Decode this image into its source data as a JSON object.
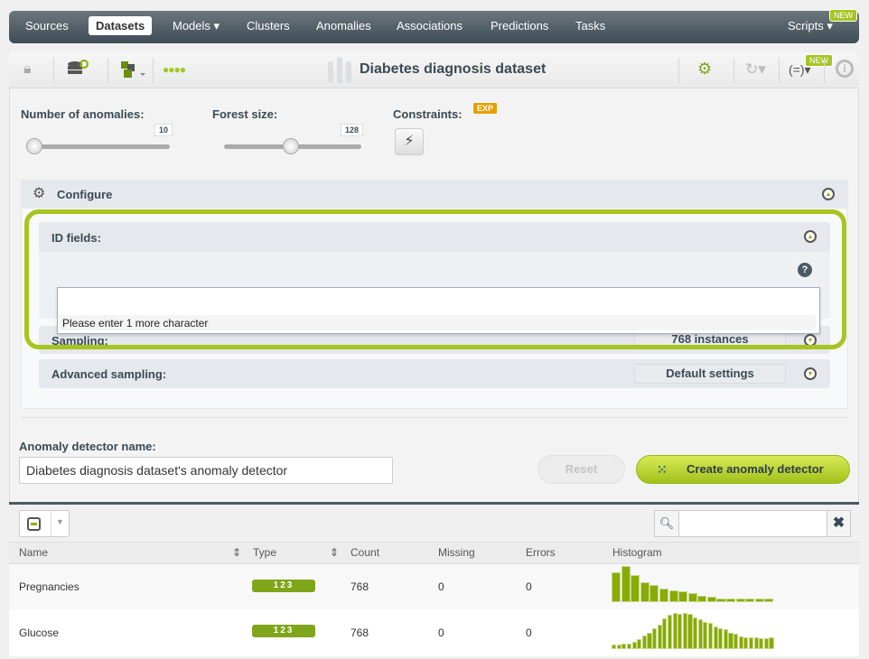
{
  "nav": {
    "items": [
      "Sources",
      "Datasets",
      "Models",
      "Clusters",
      "Anomalies",
      "Associations",
      "Predictions",
      "Tasks"
    ],
    "active": "Datasets",
    "scripts": "Scripts",
    "new_badge": "NEW"
  },
  "toolbar": {
    "title": "Diabetes diagnosis dataset",
    "new_badge": "NEW",
    "formula": "(=)"
  },
  "params": {
    "anomalies_label": "Number of anomalies:",
    "anomalies_value": "10",
    "forest_label": "Forest size:",
    "forest_value": "128",
    "constraints_label": "Constraints:",
    "exp_badge": "EXP"
  },
  "configure": {
    "title": "Configure",
    "id_fields": "ID fields:",
    "help": "?",
    "id_input_value": "",
    "dropdown_message": "Please enter 1 more character",
    "sampling": "Sampling:",
    "sampling_value": "768 instances",
    "advanced": "Advanced sampling:",
    "advanced_value": "Default settings"
  },
  "name": {
    "label": "Anomaly detector name:",
    "value": "Diabetes diagnosis dataset's anomaly detector",
    "reset": "Reset",
    "create": "Create anomaly detector"
  },
  "table": {
    "search_value": "",
    "columns": [
      "Name",
      "Type",
      "Count",
      "Missing",
      "Errors",
      "Histogram"
    ],
    "rows": [
      {
        "name": "Pregnancies",
        "type": "123",
        "count": "768",
        "missing": "0",
        "errors": "0",
        "histogram": [
          32,
          39,
          29,
          21,
          19,
          15,
          13,
          12,
          10,
          7,
          6,
          4,
          4,
          4,
          4,
          4,
          4
        ]
      },
      {
        "name": "Glucose",
        "type": "123",
        "count": "768",
        "missing": "0",
        "errors": "0",
        "histogram": [
          5,
          5,
          6,
          6,
          8,
          11,
          15,
          18,
          22,
          26,
          33,
          37,
          39,
          38,
          39,
          38,
          34,
          32,
          29,
          28,
          24,
          22,
          21,
          18,
          17,
          14,
          13,
          13,
          13,
          12,
          12,
          13
        ]
      }
    ]
  },
  "colors": {
    "accent": "#a6c520",
    "nav": "#4a5760",
    "histogram": "#8aaa06"
  }
}
